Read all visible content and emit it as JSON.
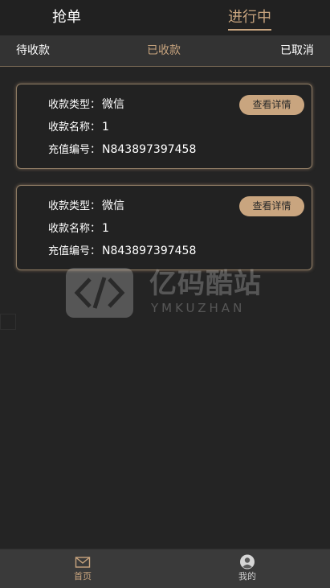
{
  "top_tabs": {
    "grab": "抢单",
    "ongoing": "进行中"
  },
  "sub_tabs": {
    "pending": "待收款",
    "received": "已收款",
    "cancelled": "已取消"
  },
  "orders": [
    {
      "type_label": "收款类型：",
      "type_value": "微信",
      "name_label": "收款名称：",
      "name_value": "1",
      "number_label": "充值编号：",
      "number_value": "N843897397458",
      "detail_button": "查看详情"
    },
    {
      "type_label": "收款类型：",
      "type_value": "微信",
      "name_label": "收款名称：",
      "name_value": "1",
      "number_label": "充值编号：",
      "number_value": "N843897397458",
      "detail_button": "查看详情"
    }
  ],
  "watermark": {
    "title": "亿码酷站",
    "subtitle": "YMKUZHAN"
  },
  "bottom_nav": {
    "home": "首页",
    "mine": "我的"
  },
  "colors": {
    "accent": "#c9a57f",
    "background": "#242424",
    "subbar": "#333333",
    "nav": "#3a3a3a"
  },
  "icons": {
    "home": "envelope-icon",
    "mine": "user-icon"
  }
}
